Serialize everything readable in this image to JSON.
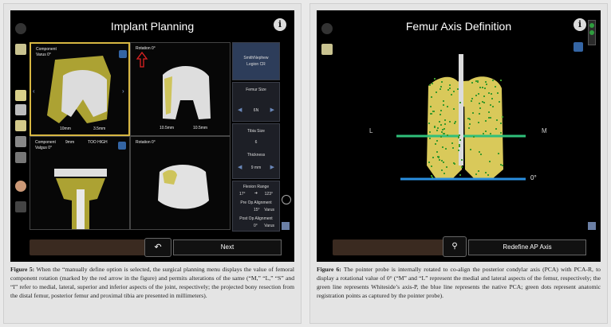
{
  "figure5": {
    "screen_title": "Implant Planning",
    "info_icon": "i",
    "views": {
      "top_left": {
        "label1": "Component",
        "label2": "Varus 0°",
        "bottom_left": "10mm",
        "bottom_right": "3.5mm"
      },
      "top_right": {
        "label1": "Rotation 0°",
        "bottom_left": "10.5mm",
        "bottom_right": "10.5mm"
      },
      "bottom_left": {
        "label1": "Component",
        "label2": "Valgus 0°",
        "label3": "9mm",
        "label4": "TOO HIGH"
      },
      "bottom_right": {
        "label1": "Rotation 0°"
      }
    },
    "right_panel": {
      "brand_line1": "SmithNephew",
      "brand_line2": "Legion CR",
      "femur_size_label": "Femur Size",
      "femur_size_value": "6N",
      "tibia_size_label": "Tibia Size",
      "tibia_size_value": "6",
      "thickness_label": "Thickness",
      "thickness_value": "9 mm",
      "flexion_range_label": "Flexion Range",
      "flexion_from": "17°",
      "flexion_to": "123°",
      "preop_label": "Pre Op Alignment",
      "preop_value": "15°",
      "preop_unit": "Varus",
      "postop_label": "Post Op Alignment",
      "postop_value": "0°",
      "postop_unit": "Varus"
    },
    "next_label": "Next",
    "caption_label": "Figure 5:",
    "caption_text": " When the “manually define option is selected, the surgical planning menu displays the value of femoral component rotation (marked by the red arrow in the figure) and permits alterations of the same (“M,” “L,” “S” and “I” refer to medial, lateral, superior and inferior aspects of the joint, respectively; the projected bony resection from the distal femur, posterior femur and proximal tibia are presented in millimeters)."
  },
  "figure6": {
    "screen_title": "Femur Axis Definition",
    "info_icon": "i",
    "label_L": "L",
    "label_M": "M",
    "angle_label": "0°",
    "redefine_label": "Redefine AP Axis",
    "caption_label": "Figure 6:",
    "caption_text": " The pointer probe is internally rotated to co-align the posterior condylar axis (PCA) with PCA-R, to display a rotational value of 0° (“M” and “L” represent the medial and lateral aspects of the femur, respectively; the green line represents Whiteside’s axis-P, the blue line represents the native PCA; green dots represent anatomic registration points as captured by the pointer probe)."
  }
}
